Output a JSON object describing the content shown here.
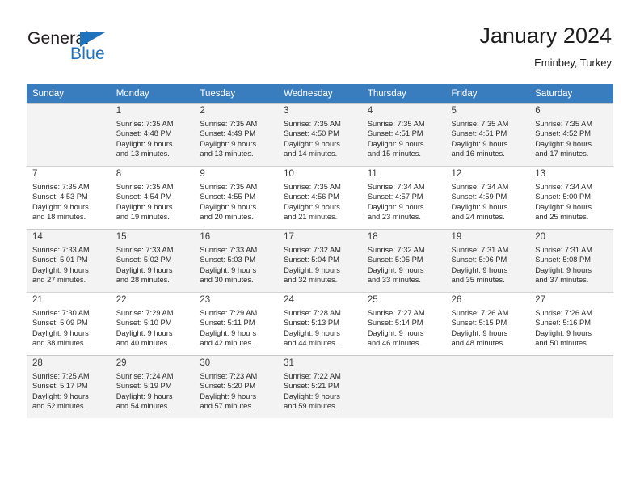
{
  "brand": {
    "name_top": "General",
    "name_bottom": "Blue",
    "triangle_icon": "triangle-logo-icon",
    "accent_color": "#1f72bd"
  },
  "header": {
    "title": "January 2024",
    "subtitle": "Eminbey, Turkey"
  },
  "calendar": {
    "header_bg": "#3a7dbf",
    "header_text_color": "#ffffff",
    "weekdays": [
      "Sunday",
      "Monday",
      "Tuesday",
      "Wednesday",
      "Thursday",
      "Friday",
      "Saturday"
    ],
    "weeks": [
      [
        {
          "day": "",
          "sunrise": "",
          "sunset": "",
          "daylight_line1": "",
          "daylight_line2": ""
        },
        {
          "day": "1",
          "sunrise": "Sunrise: 7:35 AM",
          "sunset": "Sunset: 4:48 PM",
          "daylight_line1": "Daylight: 9 hours",
          "daylight_line2": "and 13 minutes."
        },
        {
          "day": "2",
          "sunrise": "Sunrise: 7:35 AM",
          "sunset": "Sunset: 4:49 PM",
          "daylight_line1": "Daylight: 9 hours",
          "daylight_line2": "and 13 minutes."
        },
        {
          "day": "3",
          "sunrise": "Sunrise: 7:35 AM",
          "sunset": "Sunset: 4:50 PM",
          "daylight_line1": "Daylight: 9 hours",
          "daylight_line2": "and 14 minutes."
        },
        {
          "day": "4",
          "sunrise": "Sunrise: 7:35 AM",
          "sunset": "Sunset: 4:51 PM",
          "daylight_line1": "Daylight: 9 hours",
          "daylight_line2": "and 15 minutes."
        },
        {
          "day": "5",
          "sunrise": "Sunrise: 7:35 AM",
          "sunset": "Sunset: 4:51 PM",
          "daylight_line1": "Daylight: 9 hours",
          "daylight_line2": "and 16 minutes."
        },
        {
          "day": "6",
          "sunrise": "Sunrise: 7:35 AM",
          "sunset": "Sunset: 4:52 PM",
          "daylight_line1": "Daylight: 9 hours",
          "daylight_line2": "and 17 minutes."
        }
      ],
      [
        {
          "day": "7",
          "sunrise": "Sunrise: 7:35 AM",
          "sunset": "Sunset: 4:53 PM",
          "daylight_line1": "Daylight: 9 hours",
          "daylight_line2": "and 18 minutes."
        },
        {
          "day": "8",
          "sunrise": "Sunrise: 7:35 AM",
          "sunset": "Sunset: 4:54 PM",
          "daylight_line1": "Daylight: 9 hours",
          "daylight_line2": "and 19 minutes."
        },
        {
          "day": "9",
          "sunrise": "Sunrise: 7:35 AM",
          "sunset": "Sunset: 4:55 PM",
          "daylight_line1": "Daylight: 9 hours",
          "daylight_line2": "and 20 minutes."
        },
        {
          "day": "10",
          "sunrise": "Sunrise: 7:35 AM",
          "sunset": "Sunset: 4:56 PM",
          "daylight_line1": "Daylight: 9 hours",
          "daylight_line2": "and 21 minutes."
        },
        {
          "day": "11",
          "sunrise": "Sunrise: 7:34 AM",
          "sunset": "Sunset: 4:57 PM",
          "daylight_line1": "Daylight: 9 hours",
          "daylight_line2": "and 23 minutes."
        },
        {
          "day": "12",
          "sunrise": "Sunrise: 7:34 AM",
          "sunset": "Sunset: 4:59 PM",
          "daylight_line1": "Daylight: 9 hours",
          "daylight_line2": "and 24 minutes."
        },
        {
          "day": "13",
          "sunrise": "Sunrise: 7:34 AM",
          "sunset": "Sunset: 5:00 PM",
          "daylight_line1": "Daylight: 9 hours",
          "daylight_line2": "and 25 minutes."
        }
      ],
      [
        {
          "day": "14",
          "sunrise": "Sunrise: 7:33 AM",
          "sunset": "Sunset: 5:01 PM",
          "daylight_line1": "Daylight: 9 hours",
          "daylight_line2": "and 27 minutes."
        },
        {
          "day": "15",
          "sunrise": "Sunrise: 7:33 AM",
          "sunset": "Sunset: 5:02 PM",
          "daylight_line1": "Daylight: 9 hours",
          "daylight_line2": "and 28 minutes."
        },
        {
          "day": "16",
          "sunrise": "Sunrise: 7:33 AM",
          "sunset": "Sunset: 5:03 PM",
          "daylight_line1": "Daylight: 9 hours",
          "daylight_line2": "and 30 minutes."
        },
        {
          "day": "17",
          "sunrise": "Sunrise: 7:32 AM",
          "sunset": "Sunset: 5:04 PM",
          "daylight_line1": "Daylight: 9 hours",
          "daylight_line2": "and 32 minutes."
        },
        {
          "day": "18",
          "sunrise": "Sunrise: 7:32 AM",
          "sunset": "Sunset: 5:05 PM",
          "daylight_line1": "Daylight: 9 hours",
          "daylight_line2": "and 33 minutes."
        },
        {
          "day": "19",
          "sunrise": "Sunrise: 7:31 AM",
          "sunset": "Sunset: 5:06 PM",
          "daylight_line1": "Daylight: 9 hours",
          "daylight_line2": "and 35 minutes."
        },
        {
          "day": "20",
          "sunrise": "Sunrise: 7:31 AM",
          "sunset": "Sunset: 5:08 PM",
          "daylight_line1": "Daylight: 9 hours",
          "daylight_line2": "and 37 minutes."
        }
      ],
      [
        {
          "day": "21",
          "sunrise": "Sunrise: 7:30 AM",
          "sunset": "Sunset: 5:09 PM",
          "daylight_line1": "Daylight: 9 hours",
          "daylight_line2": "and 38 minutes."
        },
        {
          "day": "22",
          "sunrise": "Sunrise: 7:29 AM",
          "sunset": "Sunset: 5:10 PM",
          "daylight_line1": "Daylight: 9 hours",
          "daylight_line2": "and 40 minutes."
        },
        {
          "day": "23",
          "sunrise": "Sunrise: 7:29 AM",
          "sunset": "Sunset: 5:11 PM",
          "daylight_line1": "Daylight: 9 hours",
          "daylight_line2": "and 42 minutes."
        },
        {
          "day": "24",
          "sunrise": "Sunrise: 7:28 AM",
          "sunset": "Sunset: 5:13 PM",
          "daylight_line1": "Daylight: 9 hours",
          "daylight_line2": "and 44 minutes."
        },
        {
          "day": "25",
          "sunrise": "Sunrise: 7:27 AM",
          "sunset": "Sunset: 5:14 PM",
          "daylight_line1": "Daylight: 9 hours",
          "daylight_line2": "and 46 minutes."
        },
        {
          "day": "26",
          "sunrise": "Sunrise: 7:26 AM",
          "sunset": "Sunset: 5:15 PM",
          "daylight_line1": "Daylight: 9 hours",
          "daylight_line2": "and 48 minutes."
        },
        {
          "day": "27",
          "sunrise": "Sunrise: 7:26 AM",
          "sunset": "Sunset: 5:16 PM",
          "daylight_line1": "Daylight: 9 hours",
          "daylight_line2": "and 50 minutes."
        }
      ],
      [
        {
          "day": "28",
          "sunrise": "Sunrise: 7:25 AM",
          "sunset": "Sunset: 5:17 PM",
          "daylight_line1": "Daylight: 9 hours",
          "daylight_line2": "and 52 minutes."
        },
        {
          "day": "29",
          "sunrise": "Sunrise: 7:24 AM",
          "sunset": "Sunset: 5:19 PM",
          "daylight_line1": "Daylight: 9 hours",
          "daylight_line2": "and 54 minutes."
        },
        {
          "day": "30",
          "sunrise": "Sunrise: 7:23 AM",
          "sunset": "Sunset: 5:20 PM",
          "daylight_line1": "Daylight: 9 hours",
          "daylight_line2": "and 57 minutes."
        },
        {
          "day": "31",
          "sunrise": "Sunrise: 7:22 AM",
          "sunset": "Sunset: 5:21 PM",
          "daylight_line1": "Daylight: 9 hours",
          "daylight_line2": "and 59 minutes."
        },
        {
          "day": "",
          "sunrise": "",
          "sunset": "",
          "daylight_line1": "",
          "daylight_line2": ""
        },
        {
          "day": "",
          "sunrise": "",
          "sunset": "",
          "daylight_line1": "",
          "daylight_line2": ""
        },
        {
          "day": "",
          "sunrise": "",
          "sunset": "",
          "daylight_line1": "",
          "daylight_line2": ""
        }
      ]
    ]
  }
}
